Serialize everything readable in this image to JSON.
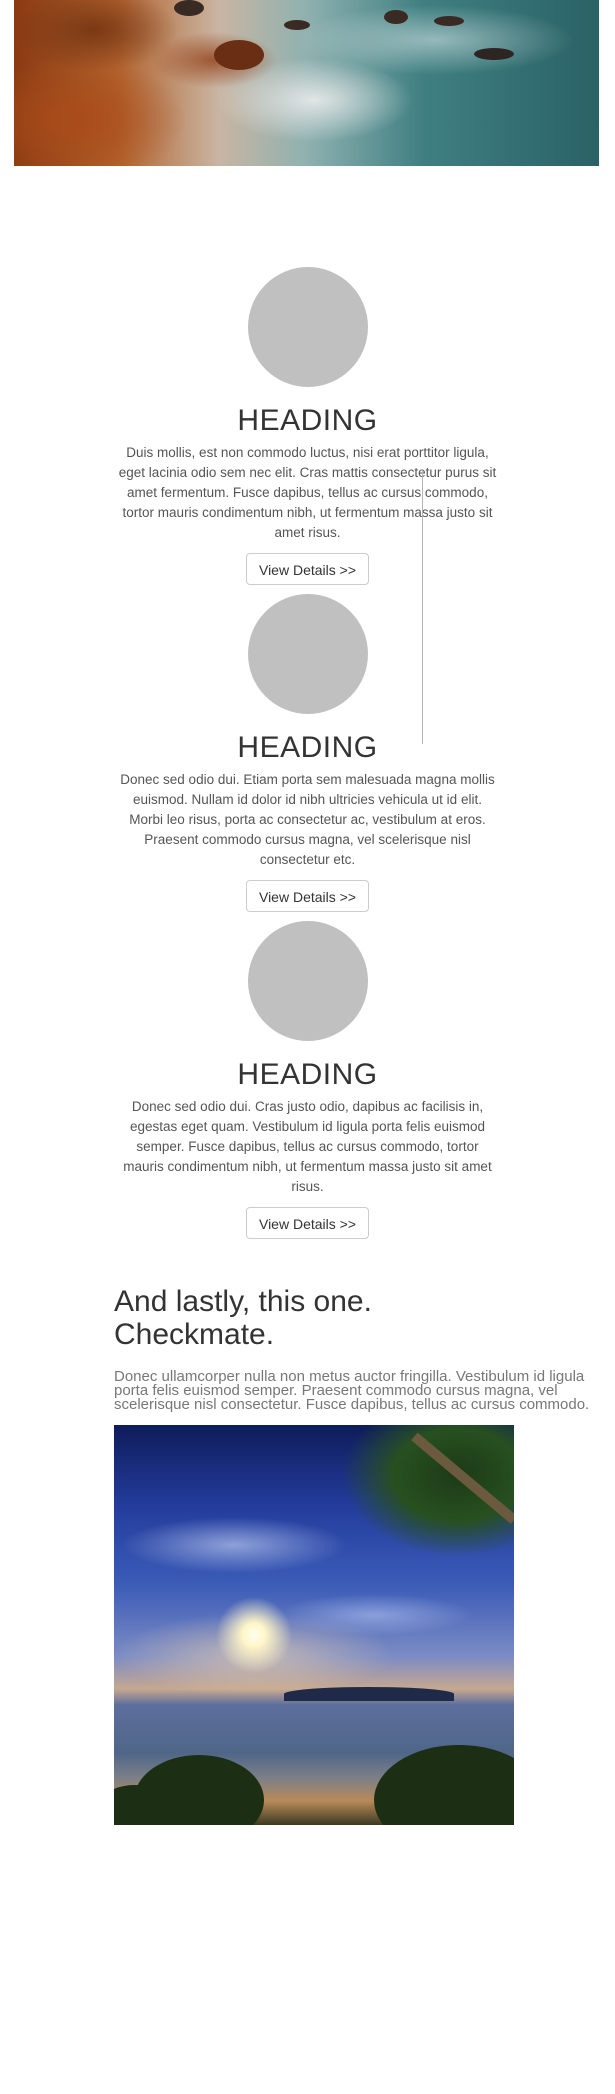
{
  "features": [
    {
      "heading": "HEADING",
      "text": "Duis mollis, est non commodo luctus, nisi erat porttitor ligula, eget lacinia odio sem nec elit. Cras mattis consectetur purus sit amet fermentum. Fusce dapibus, tellus ac cursus commodo, tortor mauris condimentum nibh, ut fermentum massa justo sit amet risus.",
      "button": "View Details >>"
    },
    {
      "heading": "HEADING",
      "text": "Donec sed odio dui. Etiam porta sem malesuada magna mollis euismod. Nullam id dolor id nibh ultricies vehicula ut id elit. Morbi leo risus, porta ac consectetur ac, vestibulum at eros. Praesent commodo cursus magna, vel scelerisque nisl consectetur etc.",
      "button": "View Details >>"
    },
    {
      "heading": "HEADING",
      "text": "Donec sed odio dui. Cras justo odio, dapibus ac facilisis in, egestas eget quam. Vestibulum id ligula porta felis euismod semper. Fusce dapibus, tellus ac cursus commodo, tortor mauris condimentum nibh, ut fermentum massa justo sit amet risus.",
      "button": "View Details >>"
    }
  ],
  "lastly": {
    "heading_line1": "And lastly, this one.",
    "heading_line2": "Checkmate.",
    "text": "Donec ullamcorper nulla non metus auctor fringilla. Vestibulum id ligula porta felis euismod semper. Praesent commodo cursus magna, vel scelerisque nisl consectetur. Fusce dapibus, tellus ac cursus commodo."
  }
}
